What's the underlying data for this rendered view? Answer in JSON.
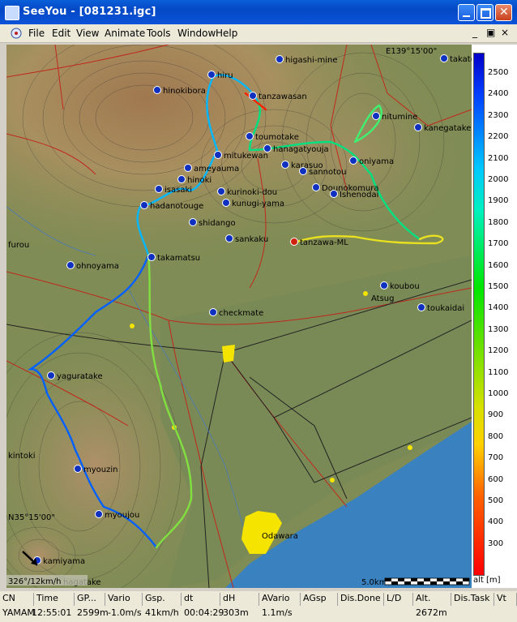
{
  "window": {
    "title": "SeeYou - [081231.igc]"
  },
  "menu": {
    "items": [
      "File",
      "Edit",
      "View",
      "Animate",
      "Tools",
      "Window",
      "Help"
    ]
  },
  "map": {
    "coord_top": "E139°15'00\"",
    "coord_left": "N35°15'00\"",
    "wind_text": "326°/12km/h",
    "scale_label": "5.0km",
    "waypoints": [
      "higashi-mine",
      "takato",
      "hiru",
      "hinokibora",
      "tanzawasan",
      "nitumine",
      "kanegatake",
      "toumotake",
      "hanagatyouja",
      "mitukewan",
      "oniyama",
      "ameyauma",
      "karasuo",
      "sannotou",
      "hinoki",
      "Dounokomura",
      "Ishenodai",
      "isasaki",
      "kurinoki-dou",
      "hadanotouge",
      "kunugi-yama",
      "shidango",
      "sankaku",
      "tanzawa-ML",
      "furou",
      "ohnoyama",
      "takamatsu",
      "koubou",
      "Atsug",
      "toukaidai",
      "checkmate",
      "yaguratake",
      "kintoki",
      "myouzin",
      "myoujou",
      "Odawara",
      "kamiyama",
      "hagatake"
    ]
  },
  "legend": {
    "unit": "alt [m]",
    "ticks": [
      "2500",
      "2400",
      "2300",
      "2200",
      "2100",
      "2000",
      "1900",
      "1800",
      "1700",
      "1600",
      "1500",
      "1400",
      "1300",
      "1200",
      "1100",
      "1000",
      "900",
      "800",
      "700",
      "600",
      "500",
      "400",
      "300"
    ],
    "colors": {
      "high": "#0000c8",
      "mid": "#00e600",
      "low": "#ff0000"
    }
  },
  "status": {
    "headers": [
      "CN",
      "Time",
      "GP...",
      "Vario",
      "Gsp.",
      "dt",
      "dH",
      "AVario",
      "AGsp",
      "Dis.Done",
      "L/D",
      "Alt.",
      "Dis.Task",
      "Vt"
    ],
    "values": [
      "YAMAM",
      "12:55:01",
      "2599m",
      "-1.0m/s",
      "41km/h",
      "00:04:29",
      "303m",
      "1.1m/s",
      "",
      "",
      "",
      "2672m",
      "",
      ""
    ]
  }
}
